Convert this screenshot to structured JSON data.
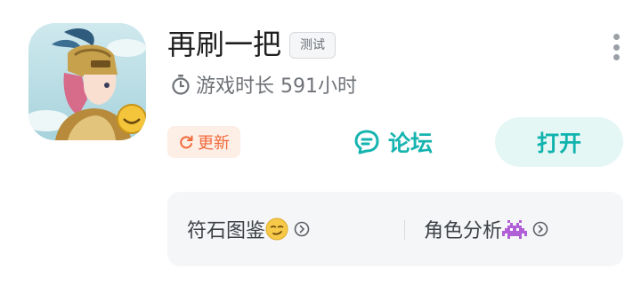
{
  "app": {
    "title": "再刷一把",
    "badge": "测试",
    "playtime": "游戏时长 591小时"
  },
  "actions": {
    "update_label": "更新",
    "forum_label": "论坛",
    "open_label": "打开"
  },
  "shortcuts": [
    {
      "label": "符石图鉴",
      "emoji_icon": "smirk-face-icon"
    },
    {
      "label": "角色分析",
      "emoji_icon": "space-invader-icon"
    }
  ],
  "colors": {
    "accent": "#16b4b0",
    "update": "#f16a3a",
    "update_bg": "#fdeee6",
    "open_bg": "#e4f7f5",
    "panel_bg": "#f5f6f8"
  }
}
